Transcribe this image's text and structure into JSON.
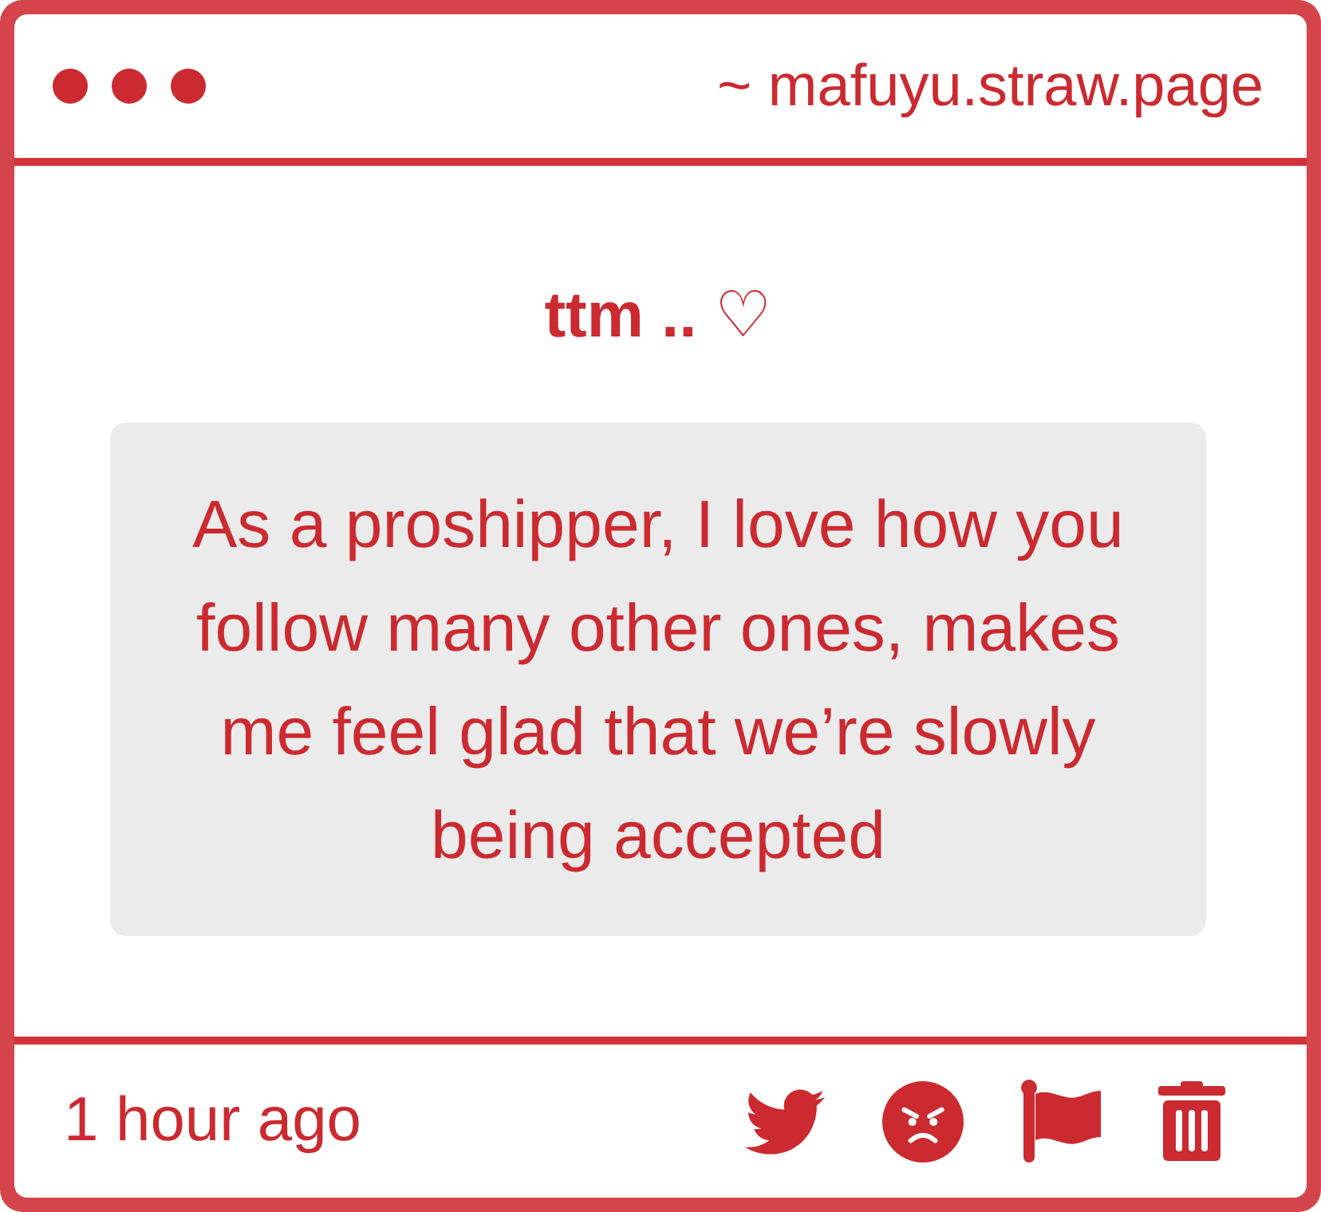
{
  "window": {
    "url": "~ mafuyu.straw.page"
  },
  "post": {
    "title": "ttm .. ♡",
    "message": "As a proshipper, I love how you follow many other ones, makes me feel glad that we’re slowly being accepted"
  },
  "footer": {
    "time": "1 hour ago",
    "actions": [
      {
        "kind": "bird"
      },
      {
        "kind": "angry"
      },
      {
        "kind": "flag"
      },
      {
        "kind": "trash"
      }
    ]
  }
}
